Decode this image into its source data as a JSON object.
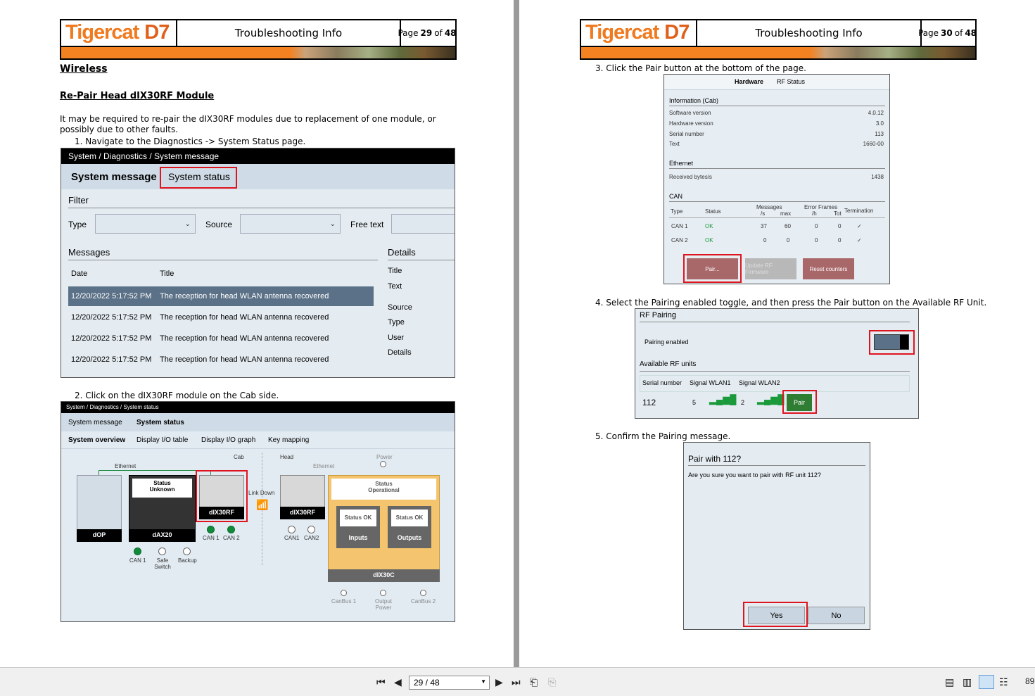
{
  "pages": [
    {
      "logo": "Tigercat",
      "logo_model": "D7",
      "doc_title": "Troubleshooting Info",
      "page_label": "Page",
      "page_num": "29",
      "page_of": "of",
      "page_total": "48"
    },
    {
      "logo": "Tigercat",
      "logo_model": "D7",
      "doc_title": "Troubleshooting Info",
      "page_label": "Page",
      "page_num": "30",
      "page_of": "of",
      "page_total": "48"
    }
  ],
  "p29": {
    "section": "Wireless",
    "subsection": "Re-Pair Head dIX30RF Module",
    "intro": "It may be required to re-pair the dIX30RF modules due to replacement of one module, or possibly due to other faults.",
    "step1": "1.   Navigate to the Diagnostics -> System Status page.",
    "step2": "2.   Click on the dIX30RF module on the Cab side.",
    "shot1": {
      "breadcrumb": "System / Diagnostics / System message",
      "tab_active": "System message",
      "tab_other": "System status",
      "filter": "Filter",
      "type": "Type",
      "source": "Source",
      "free_text": "Free text",
      "messages": "Messages",
      "details": "Details",
      "col_date": "Date",
      "col_title": "Title",
      "rows": [
        {
          "date": "12/20/2022 5:17:52 PM",
          "title": "The reception for head WLAN antenna recovered"
        },
        {
          "date": "12/20/2022 5:17:52 PM",
          "title": "The reception for head WLAN antenna recovered"
        },
        {
          "date": "12/20/2022 5:17:52 PM",
          "title": "The reception for head WLAN antenna recovered"
        },
        {
          "date": "12/20/2022 5:17:52 PM",
          "title": "The reception for head WLAN antenna recovered"
        }
      ],
      "detail_labels": {
        "title": "Title",
        "text": "Text",
        "source": "Source",
        "type": "Type",
        "user": "User",
        "details": "Details"
      }
    },
    "shot2": {
      "breadcrumb": "System / Diagnostics / System status",
      "tab1": "System message",
      "tab2": "System status",
      "sub1": "System overview",
      "sub2": "Display I/O table",
      "sub3": "Display I/O graph",
      "sub4": "Key mapping",
      "ethernet": "Ethernet",
      "cab": "Cab",
      "head": "Head",
      "ethernet2": "Ethernet",
      "power": "Power",
      "status_unknown": "Status Unknown",
      "status_operational": "Status Operational",
      "dop": "dOP",
      "dax20": "dAX20",
      "dix30rf": "dIX30RF",
      "dix30rf_head": "dIX30RF",
      "link_down": "Link Down",
      "status_ok1": "Status OK",
      "status_ok2": "Status OK",
      "inputs": "Inputs",
      "outputs": "Outputs",
      "dix30c": "dIX30C",
      "can1": "CAN 1",
      "can2": "CAN 2",
      "cab_can1": "CAN 1",
      "safe_switch": "Safe Switch",
      "backup": "Backup",
      "head_can1": "CAN1",
      "head_can2": "CAN2",
      "canbus1": "CanBus 1",
      "output_power": "Output Power",
      "canbus2": "CanBus 2"
    }
  },
  "p30": {
    "step3": "3.   Click the Pair button at the bottom of the page.",
    "step4": "4.   Select the Pairing enabled toggle, and then press the Pair button on the Available RF Unit.",
    "step5": "5.   Confirm the Pairing message.",
    "hw": {
      "tab_hardware": "Hardware",
      "tab_rf": "RF Status",
      "info_cab": "Information (Cab)",
      "info_rows": [
        {
          "k": "Software version",
          "v": "4.0.12"
        },
        {
          "k": "Hardware version",
          "v": "3.0"
        },
        {
          "k": "Serial number",
          "v": "113"
        },
        {
          "k": "Text",
          "v": "1660-00"
        }
      ],
      "ethernet": "Ethernet",
      "received": "Received bytes/s",
      "received_v": "1438",
      "can": "CAN",
      "can_head": {
        "type": "Type",
        "status": "Status",
        "messages": "Messages",
        "per_s": "/s",
        "max": "max",
        "error_frames": "Error Frames",
        "per_h": "/h",
        "tot": "Tot",
        "termination": "Termination"
      },
      "can_rows": [
        {
          "type": "CAN 1",
          "status": "OK",
          "ps": "37",
          "max": "60",
          "ph": "0",
          "tot": "0",
          "term": "✓"
        },
        {
          "type": "CAN 2",
          "status": "OK",
          "ps": "0",
          "max": "0",
          "ph": "0",
          "tot": "0",
          "term": "✓"
        }
      ],
      "btn_pair": "Pair...",
      "btn_update": "Update RF Firmware",
      "btn_reset": "Reset counters"
    },
    "rf": {
      "title": "RF Pairing",
      "pairing_enabled": "Pairing enabled",
      "available": "Available RF units",
      "col_serial": "Serial number",
      "col_w1": "Signal WLAN1",
      "col_w2": "Signal WLAN2",
      "serial": "112",
      "w1": "5",
      "w2": "2",
      "pair": "Pair"
    },
    "dialog": {
      "title": "Pair with 112?",
      "message": "Are you sure you want to pair with RF unit 112?",
      "yes": "Yes",
      "no": "No"
    }
  },
  "toolbar": {
    "page_field": "29 / 48",
    "zoom": "89"
  }
}
